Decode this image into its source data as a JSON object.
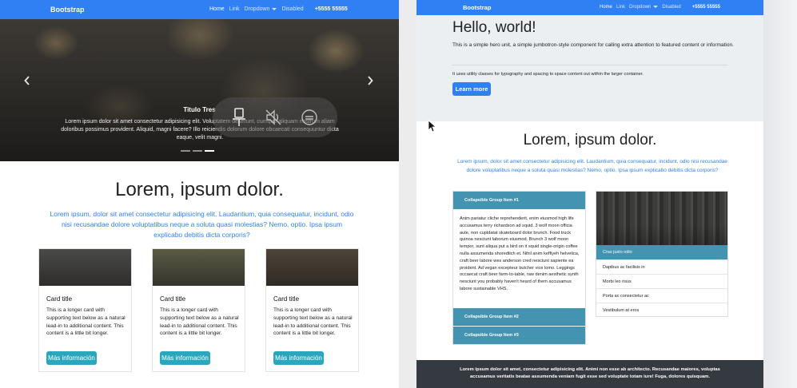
{
  "left": {
    "navbar": {
      "brand": "Bootstrap",
      "links": [
        "Home",
        "Link",
        "Dropdown",
        "Disabled"
      ],
      "phone": "+5555 55555"
    },
    "carousel": {
      "caption_title": "Titulo Tres",
      "caption_text": "Lorem ipsum dolor sit amet consectetur adipisicing elit. Voluptatem deserunt, cumque aliquam nostrum aliam doloribus possimus provident. Aliquid, magni facere? Illo reiciendis dolorum dolore obcaecati consequuntur dicta eaque, velit magni.",
      "prev_icon": "chevron-left-icon",
      "next_icon": "chevron-right-icon",
      "indicators": 3,
      "active_indicator": 3
    },
    "section": {
      "heading": "Lorem, ipsum dolor.",
      "lead": "Lorem ipsum, dolor sit amet consectetur adipisicing elit. Laudantium, quia consequatur, incidunt, odio nisi recusandae dolore voluptatibus neque a soluta quasi molestias? Nemo, optio. Ipsa ipsum explicabo debitis dicta corporis?"
    },
    "cards": [
      {
        "title": "Card title",
        "text": "This is a longer card with supporting text below as a natural lead-in to additional content. This content is a little bit longer.",
        "button": "Más información"
      },
      {
        "title": "Card title",
        "text": "This is a longer card with supporting text below as a natural lead-in to additional content. This content is a little bit longer.",
        "button": "Más información"
      },
      {
        "title": "Card title",
        "text": "This is a longer card with supporting text below as a natural lead-in to additional content. This content is a little bit longer.",
        "button": "Más información"
      }
    ]
  },
  "media_overlay": {
    "icons": [
      "pin-icon",
      "mute-icon",
      "subtitles-icon"
    ]
  },
  "right": {
    "navbar": {
      "brand": "Bootstrap",
      "links": [
        "Home",
        "Link",
        "Dropdown",
        "Disabled"
      ],
      "phone": "+5555 55555"
    },
    "jumbotron": {
      "title": "Hello, world!",
      "lead": "This is a simple hero unit, a simple jumbotron-style component for calling extra attention to featured content or information.",
      "text": "It uses utility classes for typography and spacing to space content out within the larger container.",
      "button": "Learn more"
    },
    "section": {
      "heading": "Lorem, ipsum dolor.",
      "lead": "Lorem ipsum, dolor sit amet consectetur adipisicing elit. Laudantium, quia consequatur, incidunt, odio nisi recusandae dolore voluptatibus neque a soluta quasi molestias? Nemo, optio. Ipsa ipsum explicabo debitis dicta corporis?"
    },
    "accordion": {
      "items": [
        "Collapsible Group Item #1",
        "Collapsible Group Item #2",
        "Collapsible Group Item #3"
      ],
      "body": "Anim pariatur cliche reprehenderit, enim eiusmod high life accusamus terry richardson ad squid. 3 wolf moon officia aute, non cupidatat skateboard dolor brunch. Food truck quinoa nesciunt laborum eiusmod. Brunch 3 wolf moon tempor, sunt aliqua put a bird on it squid single-origin coffee nulla assumenda shoreditch et. Nihil anim keffiyeh helvetica, craft beer labore wes anderson cred nesciunt sapiente ea proident. Ad vegan excepteur butcher vice lomo. Leggings occaecat craft beer farm-to-table, raw denim aesthetic synth nesciunt you probably haven't heard of them accusamus labore sustainable VHS."
    },
    "list_group": {
      "active": "Cras justo odio",
      "items": [
        "Dapibus ac facilisis in",
        "Morbi leo risus",
        "Porta ac consectetur ac",
        "Vestibulum at eros"
      ]
    },
    "footer": {
      "text": "Lorem ipsum dolor sit amet, consectetur adipisicing elit. Animi non esse ab architecto. Recusandae maiores, voluptas accusamus veritatis beatae assumenda veniam fugit esse sed voluptate totam iure! Fuga, dolores quisquam."
    }
  },
  "colors": {
    "navbar": "#2f80f3",
    "accent_text": "#2f80f3",
    "info_button": "#2aa7bd",
    "accordion_header": "#4393b1",
    "footer": "#353a40"
  }
}
